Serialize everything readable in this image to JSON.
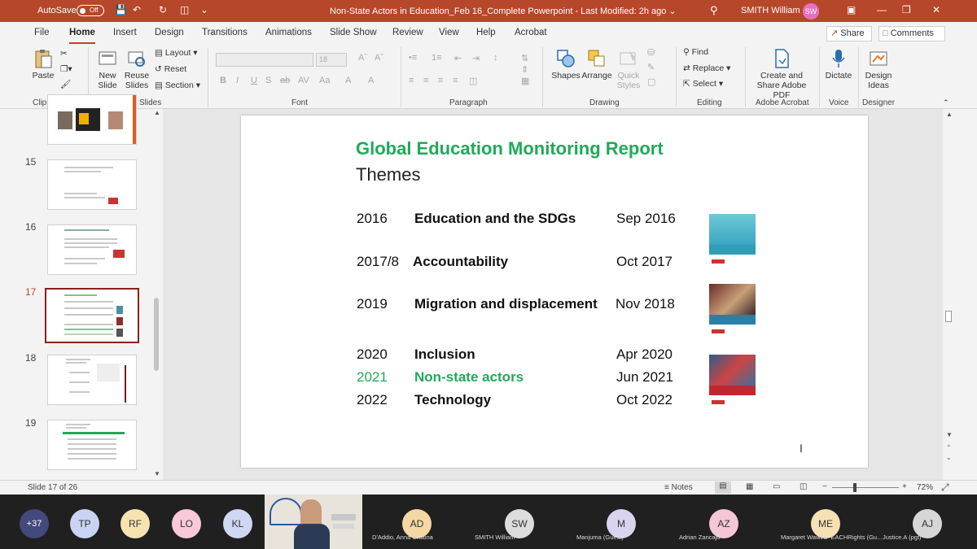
{
  "titlebar": {
    "autosave_label": "AutoSave",
    "autosave_state": "Off",
    "document_title": "Non-State Actors in Education_Feb 16_Complete Powerpoint  -  Last Modified: 2h ago  ⌄",
    "user_name": "SMITH William",
    "user_initials": "SW",
    "accent": "#b7472a"
  },
  "tabs": [
    "File",
    "Home",
    "Insert",
    "Design",
    "Transitions",
    "Animations",
    "Slide Show",
    "Review",
    "View",
    "Help",
    "Acrobat"
  ],
  "active_tab": "Home",
  "share_label": "Share",
  "comments_label": "Comments",
  "ribbon": {
    "clipboard": {
      "paste": "Paste",
      "group": "Clipboard"
    },
    "slides": {
      "new_slide": "New Slide",
      "reuse_slides": "Reuse Slides",
      "layout": "Layout",
      "reset": "Reset",
      "section": "Section",
      "group": "Slides"
    },
    "font": {
      "size": "18",
      "group": "Font",
      "buttons": [
        "B",
        "I",
        "U",
        "S",
        "ab",
        "AV",
        "Aa",
        "A",
        "A"
      ]
    },
    "paragraph": {
      "group": "Paragraph"
    },
    "drawing": {
      "shapes": "Shapes",
      "arrange": "Arrange",
      "quick_styles": "Quick Styles",
      "group": "Drawing"
    },
    "editing": {
      "find": "Find",
      "replace": "Replace",
      "select": "Select",
      "group": "Editing"
    },
    "acrobat": {
      "create_share": "Create and Share Adobe PDF",
      "group": "Adobe Acrobat"
    },
    "voice": {
      "dictate": "Dictate",
      "group": "Voice"
    },
    "designer": {
      "design_ideas": "Design Ideas",
      "group": "Designer"
    }
  },
  "thumbnails": [
    {
      "num": "15",
      "title": "GEM: Global Education Monitoring Report"
    },
    {
      "num": "16",
      "title": "Global Education Monitoring Report"
    },
    {
      "num": "17",
      "title": "Global Education Monitoring Report"
    },
    {
      "num": "18",
      "title": "2021 GEM Report"
    },
    {
      "num": "19",
      "title": "2021 GEM Report"
    }
  ],
  "slide": {
    "title": "Global Education Monitoring Report",
    "subtitle": "Themes",
    "rows": [
      {
        "year": "2016",
        "theme": "Education and the SDGs",
        "date": "Sep 2016",
        "highlight": false
      },
      {
        "year": "2017/8",
        "theme": "Accountability",
        "date": "Oct 2017",
        "highlight": false
      },
      {
        "year": "2019",
        "theme": "Migration and displacement",
        "date": "Nov 2018",
        "highlight": false
      },
      {
        "year": "2020",
        "theme": "Inclusion",
        "date": "Apr 2020",
        "highlight": false
      },
      {
        "year": "2021",
        "theme": "Non-state actors",
        "date": "Jun 2021",
        "highlight": true
      },
      {
        "year": "2022",
        "theme": "Technology",
        "date": "Oct 2022",
        "highlight": false
      }
    ],
    "highlight_color": "#1faa59"
  },
  "status": {
    "slide_counter": "Slide 17 of 26",
    "notes": "Notes",
    "zoom": "72%"
  },
  "meeting": {
    "more_count": "+37",
    "participants": [
      {
        "initials": "TP",
        "color": "#c9d4f2"
      },
      {
        "initials": "RF",
        "color": "#f7e3b1"
      },
      {
        "initials": "LO",
        "color": "#f8c9d9"
      },
      {
        "initials": "KL",
        "color": "#cfd7f2"
      },
      {
        "initials": "AD",
        "color": "#f4d7a3",
        "name": "D'Addio, Anna Cristina"
      },
      {
        "initials": "SW",
        "color": "#dcdcdc",
        "name": "SMITH William"
      },
      {
        "initials": "M",
        "color": "#d9d3f0",
        "name": "Manjuma (Guest)"
      },
      {
        "initials": "AZ",
        "color": "#f4c6d6",
        "name": "Adrian Zancajo"
      },
      {
        "initials": "ME",
        "color": "#f6e0b4",
        "name": "Margaret Wawira- EACHRights (Gu..."
      },
      {
        "initials": "AJ",
        "color": "#d6d6d6",
        "name": "Justice.A (pgt)"
      }
    ]
  }
}
